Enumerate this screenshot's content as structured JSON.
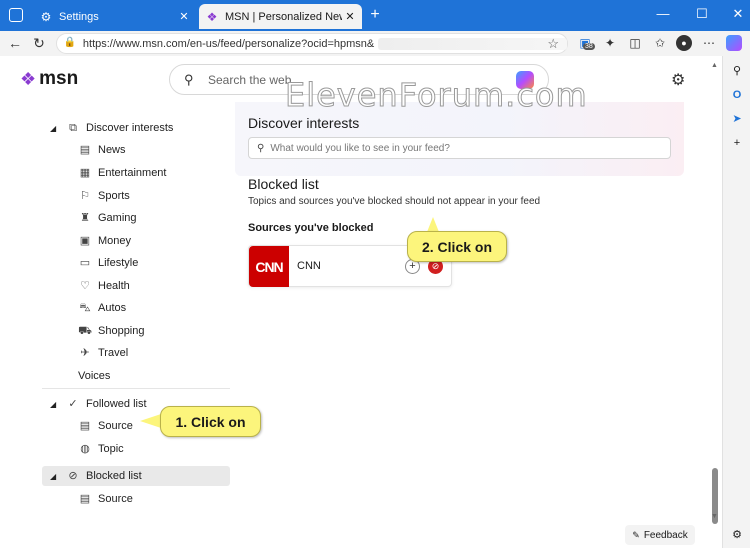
{
  "tabs": {
    "inactive": {
      "label": "Settings",
      "icon": "gear-icon"
    },
    "active": {
      "label": "MSN | Personalized News, Top He",
      "icon": "msn-butterfly-icon"
    }
  },
  "address": {
    "url": "https://www.msn.com/en-us/feed/personalize?ocid=hpmsn&"
  },
  "header": {
    "logo": "msn",
    "search_placeholder": "Search the web"
  },
  "watermark": "ElevenForum.com",
  "sidebar": {
    "discover": "Discover interests",
    "items": [
      "News",
      "Entertainment",
      "Sports",
      "Gaming",
      "Money",
      "Lifestyle",
      "Health",
      "Autos",
      "Shopping",
      "Travel",
      "Voices"
    ],
    "followed": "Followed list",
    "followed_items": [
      "Source",
      "Topic"
    ],
    "blocked": "Blocked list",
    "blocked_items": [
      "Source"
    ]
  },
  "main": {
    "discover_title": "Discover interests",
    "interest_placeholder": "What would you like to see in your feed?",
    "blocked_title": "Blocked list",
    "blocked_desc": "Topics and sources you've blocked should not appear in your feed",
    "sources_title": "Sources you've blocked",
    "source": {
      "logo": "CNN",
      "name": "CNN"
    }
  },
  "callouts": {
    "one": "1. Click on",
    "two": "2. Click on"
  },
  "feedback": "Feedback",
  "badge": "38",
  "colors": {
    "accent": "#1f73d7",
    "block_red": "#d11f1f",
    "callout": "#fcf57c",
    "cnn_red": "#cc0000"
  }
}
